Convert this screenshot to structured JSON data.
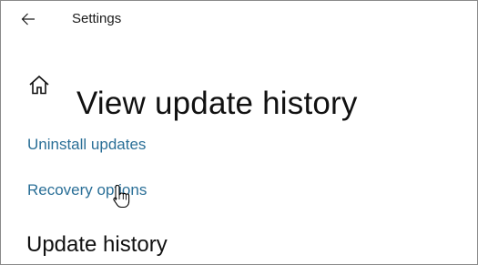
{
  "window": {
    "app_title": "Settings"
  },
  "titlebar": {
    "back_icon": "back-arrow-icon"
  },
  "header": {
    "home_icon": "home-icon",
    "title": "View update history"
  },
  "links": {
    "uninstall_updates": "Uninstall updates",
    "recovery_options": "Recovery options"
  },
  "sections": {
    "update_history_title": "Update history"
  },
  "colors": {
    "link": "#2a6f97",
    "text": "#111111",
    "background": "#ffffff"
  },
  "cursor": {
    "icon": "hand-pointer-cursor"
  }
}
